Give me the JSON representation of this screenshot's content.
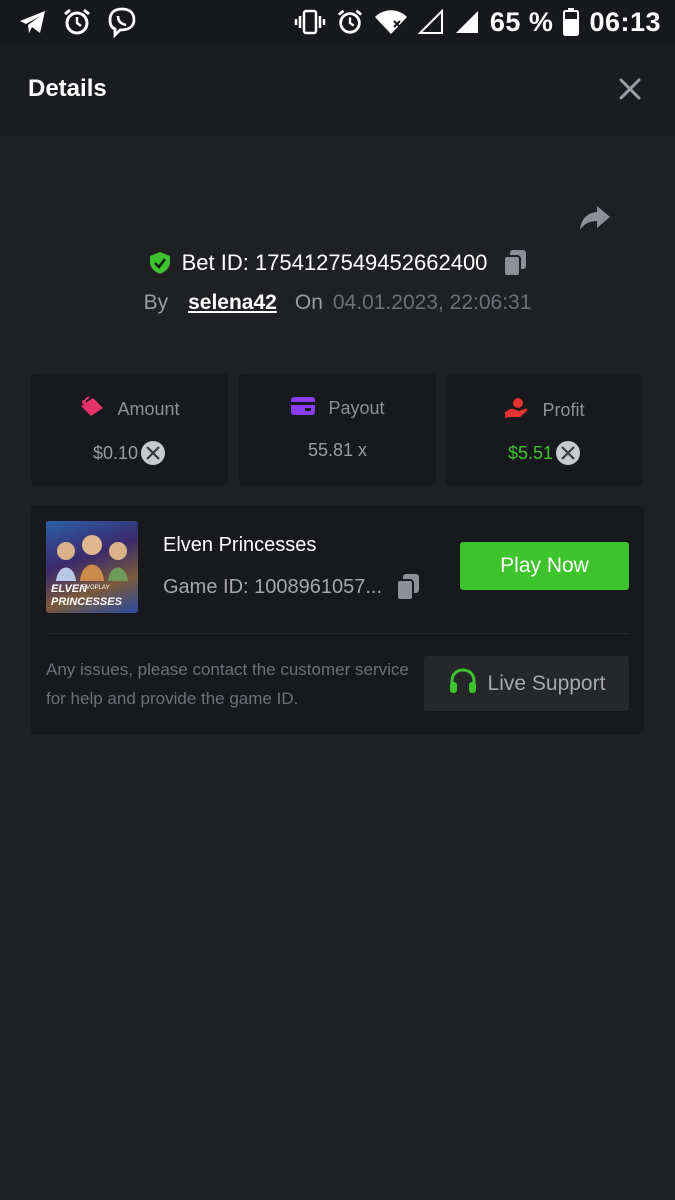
{
  "status_bar": {
    "battery": "65 %",
    "time": "06:13",
    "left_icons": [
      "telegram-icon",
      "alarm-icon",
      "viber-icon"
    ],
    "right_icons": [
      "vibrate-icon",
      "alarm-icon",
      "wifi-icon",
      "signal-empty-icon",
      "signal-icon",
      "battery-icon"
    ]
  },
  "header": {
    "title": "Details",
    "close_icon": "close-icon"
  },
  "bet": {
    "id_label": "Bet ID: 1754127549452662400",
    "by_label": "By",
    "user": "selena42",
    "on_label": "On",
    "date": "04.01.2023, 22:06:31"
  },
  "stats": {
    "amount": {
      "label": "Amount",
      "value": "$0.10",
      "icon": "ticket-icon"
    },
    "payout": {
      "label": "Payout",
      "value": "55.81 x",
      "icon": "card-icon"
    },
    "profit": {
      "label": "Profit",
      "value": "$5.51",
      "icon": "hand-coin-icon"
    }
  },
  "game": {
    "name": "Elven Princesses",
    "id_label": "Game ID: 1008961057...",
    "play_label": "Play Now",
    "thumb_text_1": "ELVEN",
    "thumb_text_2": "PRINCESSES",
    "thumb_text_3": "EVOPLAY"
  },
  "support": {
    "help_text": "Any issues, please contact the customer service for help and provide the game ID.",
    "button_label": "Live Support"
  },
  "colors": {
    "background": "#1f2023",
    "card": "#18191c",
    "accent_green": "#3dc32b",
    "muted": "#6d7077"
  }
}
